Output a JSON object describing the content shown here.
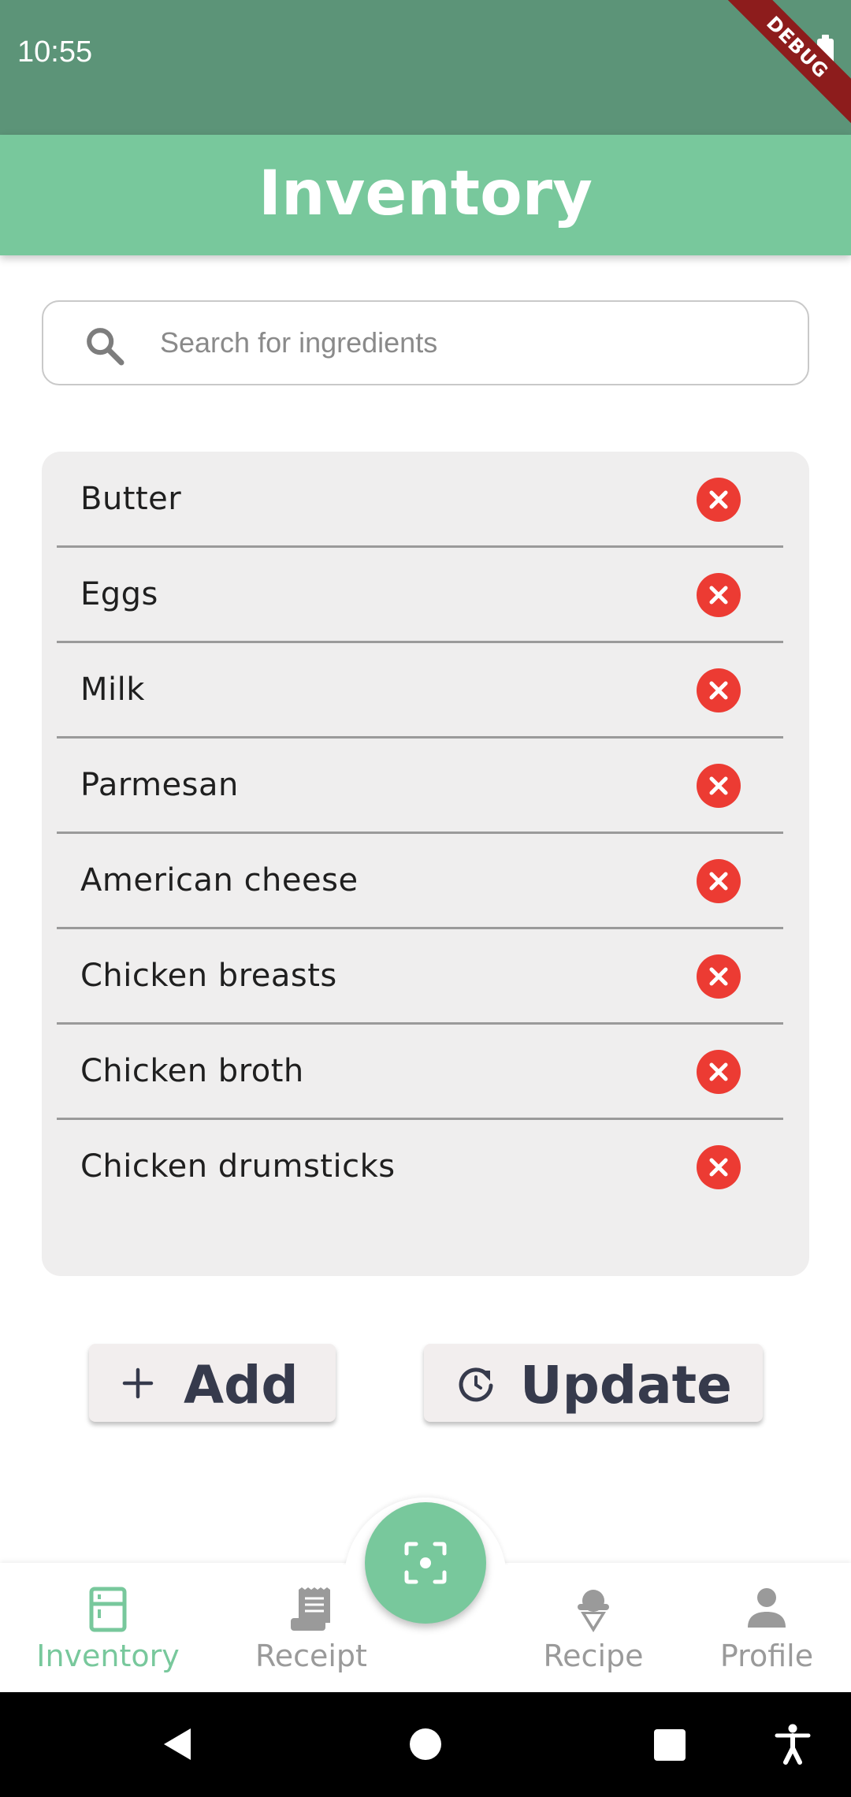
{
  "status_bar": {
    "time": "10:55",
    "debug_banner": "DEBUG"
  },
  "app_bar": {
    "title": "Inventory"
  },
  "search": {
    "placeholder": "Search for ingredients",
    "value": ""
  },
  "inventory": {
    "items": [
      {
        "label": "Butter"
      },
      {
        "label": "Eggs"
      },
      {
        "label": "Milk"
      },
      {
        "label": "Parmesan"
      },
      {
        "label": "American cheese"
      },
      {
        "label": "Chicken breasts"
      },
      {
        "label": "Chicken broth"
      },
      {
        "label": "Chicken drumsticks"
      }
    ],
    "remove_icon": "cancel-circle-icon"
  },
  "actions": {
    "add_label": "Add",
    "add_icon": "plus-icon",
    "update_label": "Update",
    "update_icon": "refresh-icon"
  },
  "bottom_nav": {
    "active": "inventory",
    "items": [
      {
        "label": "Inventory",
        "icon": "fridge-icon"
      },
      {
        "label": "Receipt",
        "icon": "receipt-icon"
      },
      {
        "label": "Recipe",
        "icon": "ice-cream-icon"
      },
      {
        "label": "Profile",
        "icon": "person-icon"
      }
    ],
    "fab_icon": "scan-icon"
  },
  "colors": {
    "status_bar": "#5c9478",
    "primary": "#78c89c",
    "remove_red": "#ec3b33",
    "button_text": "#363a4c",
    "card_bg": "#efeeee",
    "inactive_nav": "#9a9a9a"
  }
}
